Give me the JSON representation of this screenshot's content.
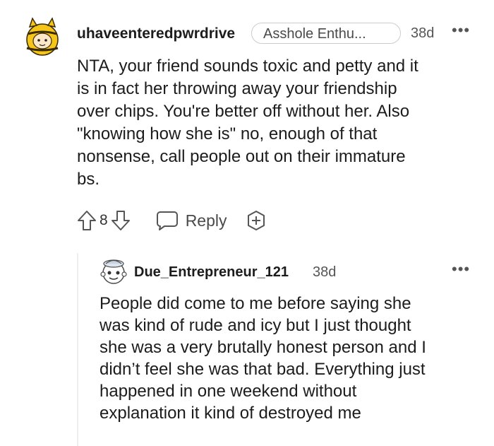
{
  "comment": {
    "username": "uhaveenteredpwrdrive",
    "flair": "Asshole Enthu...",
    "age": "38d",
    "more": "•••",
    "body_lines": [
      "NTA, your friend sounds toxic and petty and it",
      "is in fact her throwing away your friendship",
      "over chips. You're better off without her. Also",
      "\"knowing how she is\" no, enough of that",
      "nonsense, call people out on their immature",
      "bs."
    ],
    "votes": "8",
    "reply_label": "Reply"
  },
  "reply": {
    "username": "Due_Entrepreneur_121",
    "age": "38d",
    "more": "•••",
    "body_lines": [
      "People did come to me before saying she",
      "was kind of rude and icy but I just thought",
      "she was a very brutally honest person and I",
      "didn’t feel she was that bad. Everything just",
      "happened in one weekend without",
      "explanation it kind of destroyed me"
    ]
  },
  "colors": {
    "text": "#1c1c1c",
    "muted": "#555555",
    "avatar_yellow": "#f5c518",
    "thread_line": "#edeff1"
  }
}
